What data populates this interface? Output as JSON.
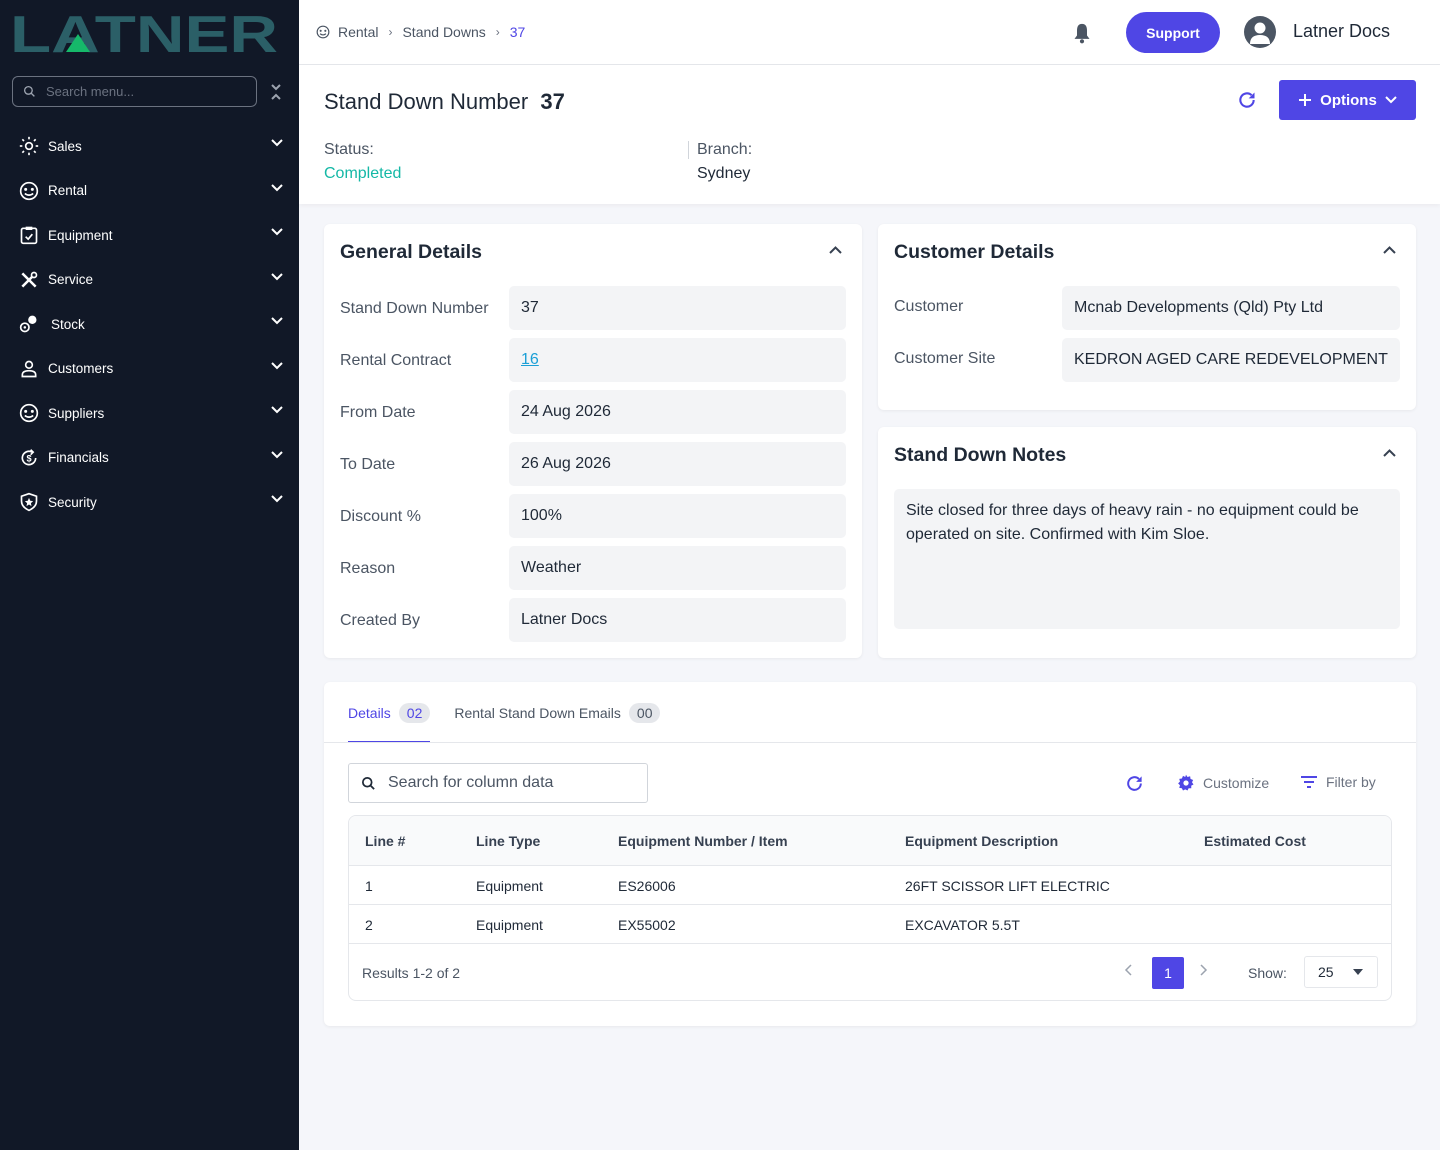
{
  "sidebar": {
    "brand": "LATNER",
    "search_placeholder": "Search menu...",
    "items": [
      {
        "label": "Sales",
        "icon": "sales-icon"
      },
      {
        "label": "Rental",
        "icon": "rental-icon"
      },
      {
        "label": "Equipment",
        "icon": "equipment-icon"
      },
      {
        "label": "Service",
        "icon": "service-icon"
      },
      {
        "label": "Stock",
        "icon": "stock-icon"
      },
      {
        "label": "Customers",
        "icon": "user-icon"
      },
      {
        "label": "Suppliers",
        "icon": "suppliers-icon"
      },
      {
        "label": "Financials",
        "icon": "financials-icon"
      },
      {
        "label": "Security",
        "icon": "shield-icon"
      }
    ]
  },
  "topbar": {
    "breadcrumb": [
      "Rental",
      "Stand Downs",
      "37"
    ],
    "support_label": "Support",
    "user_name": "Latner Docs"
  },
  "header": {
    "title": "Stand Down Number",
    "number": "37",
    "options_label": "Options",
    "status_label": "Status:",
    "status_value": "Completed",
    "branch_label": "Branch:",
    "branch_value": "Sydney",
    "status_color": "#14b8a6"
  },
  "general": {
    "title": "General Details",
    "fields": [
      {
        "label": "Stand Down Number",
        "value": "37"
      },
      {
        "label": "Rental Contract",
        "value": "16"
      },
      {
        "label": "From Date",
        "value": "24 Aug 2026"
      },
      {
        "label": "To Date",
        "value": "26 Aug 2026"
      },
      {
        "label": "Discount %",
        "value": "100%"
      },
      {
        "label": "Reason",
        "value": "Weather"
      },
      {
        "label": "Created By",
        "value": "Latner Docs"
      }
    ]
  },
  "customer": {
    "title": "Customer Details",
    "fields": [
      {
        "label": "Customer",
        "value": "Mcnab Developments (Qld) Pty Ltd"
      },
      {
        "label": "Customer Site",
        "value": "KEDRON AGED CARE REDEVELOPMENT"
      }
    ]
  },
  "notes": {
    "title": "Stand Down Notes",
    "text": "Site closed for three days of heavy rain - no equipment could be operated on site. Confirmed with Kim Sloe."
  },
  "tabs": [
    {
      "label": "Details",
      "count": "02"
    },
    {
      "label": "Rental Stand Down Emails",
      "count": "00"
    }
  ],
  "table": {
    "search_placeholder": "Search for column data",
    "customize_label": "Customize",
    "filter_label": "Filter by",
    "columns": [
      "Line #",
      "Line Type",
      "Equipment Number / Item",
      "Equipment Description",
      "Estimated Cost"
    ],
    "rows": [
      [
        "1",
        "Equipment",
        "ES26006",
        "26FT SCISSOR LIFT ELECTRIC",
        ""
      ],
      [
        "2",
        "Equipment",
        "EX55002",
        "EXCAVATOR 5.5T",
        ""
      ]
    ],
    "results_text": "Results 1-2 of 2",
    "current_page": "1",
    "show_label": "Show:",
    "page_size": "25"
  },
  "colors": {
    "accent": "#4f46e5",
    "sidebar_bg": "#111827",
    "brand_teal": "#2b5f67",
    "brand_green": "#16b96a",
    "link": "#1a9fd6"
  }
}
